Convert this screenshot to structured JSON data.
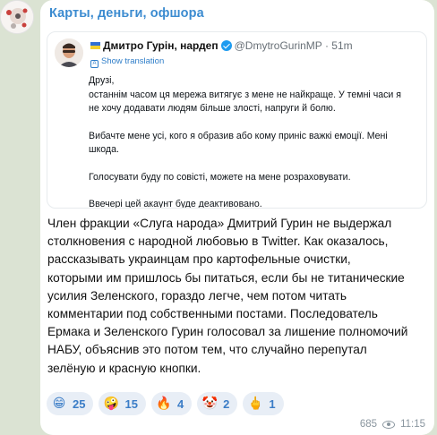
{
  "channel": {
    "title": "Карты, деньги, офшора"
  },
  "tweet": {
    "author_name": "Дмитро Гурін, нардеп",
    "handle": "@DmytroGurinMP",
    "separator": "·",
    "time": "51m",
    "show_translation": "Show translation",
    "lines": [
      "Друзі,",
      "останнім часом ця мережа витягує з мене не найкраще. У темні часи я",
      "не хочу додавати людям більше злості, напруги й болю.",
      "",
      "Вибачте мене усі, кого я образив або кому приніс важкі емоції. Мені",
      "шкода.",
      "",
      "Голосувати буду по совісті, можете на мене розраховувати.",
      "",
      "Ввечері цей акаунт буде деактивовано."
    ]
  },
  "post": {
    "lines": [
      "Член фракции «Слуга народа» Дмитрий Гурин не выдержал",
      "столкновения с народной любовью в Twitter. Как оказалось,",
      "рассказывать украинцам про картофельные очистки,",
      "которыми им пришлось бы питаться, если бы не титанические",
      "усилия Зеленского, гораздо легче, чем потом читать",
      "комментарии под собственными постами. Последователь",
      "Ермака и Зеленского Гурин голосовал за лишение полномочий",
      "НАБУ, объяснив это потом тем, что случайно перепутал",
      "зелёную и красную кнопки."
    ]
  },
  "reactions": [
    {
      "emoji": "😁",
      "count": "25"
    },
    {
      "emoji": "🤪",
      "count": "15"
    },
    {
      "emoji": "🔥",
      "count": "4"
    },
    {
      "emoji": "🤡",
      "count": "2"
    },
    {
      "emoji": "🖕",
      "count": "1"
    }
  ],
  "meta": {
    "views": "685",
    "time": "11:15"
  },
  "colors": {
    "background": "#dbe3d3",
    "accent": "#3b8bd0",
    "reaction_bg": "#e8eef6",
    "verified": "#1d9bf0"
  }
}
